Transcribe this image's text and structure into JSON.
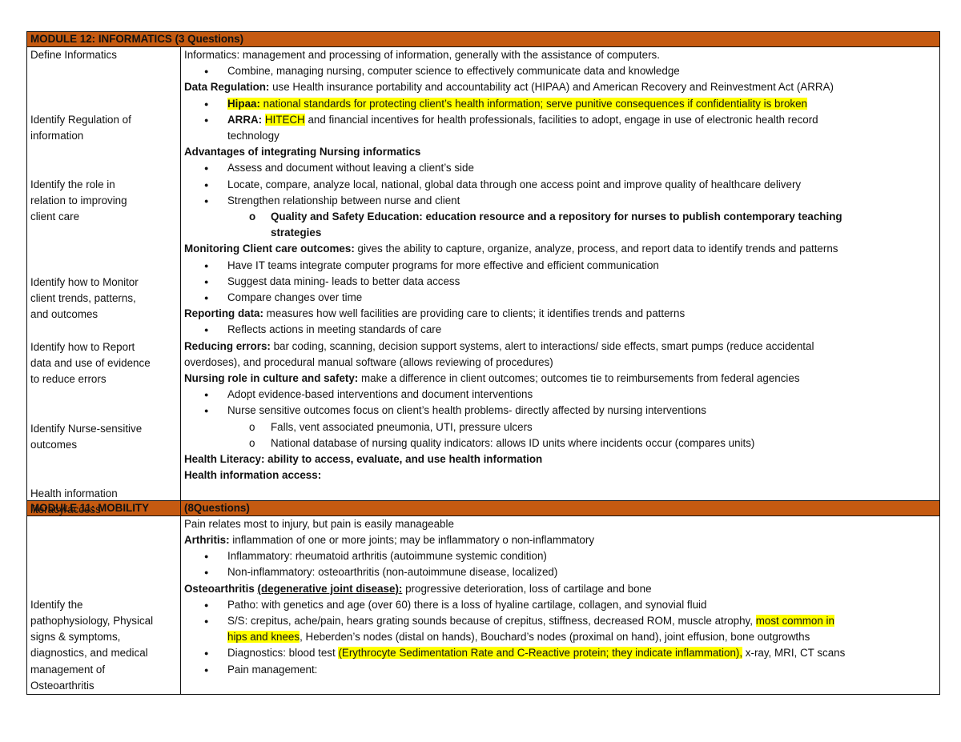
{
  "module12": {
    "header": "MODULE 12: INFORMATICS (3 Questions)",
    "left_topics": [
      "Define Informatics",
      "Identify Regulation of information",
      "Identify the role in relation to improving client care",
      "Identify how to Monitor client trends, patterns, and outcomes",
      "Identify how to Report data and use of evidence to reduce errors",
      "Identify Nurse-sensitive outcomes",
      "Health information literacy/access"
    ],
    "left_lines": {
      "t1": [
        "Define Informatics"
      ],
      "t2": [
        "Identify Regulation of",
        "information"
      ],
      "t3": [
        "Identify the role in",
        "relation to improving",
        "client care"
      ],
      "t4": [
        "Identify how to Monitor",
        "client trends, patterns,",
        "and outcomes"
      ],
      "t5": [
        "Identify how to Report",
        "data and use of evidence",
        "to reduce errors"
      ],
      "t6": [
        "Identify Nurse-sensitive",
        "outcomes"
      ],
      "t7": [
        "Health information",
        "literacy/access"
      ]
    },
    "content": {
      "informatics_term": "Informatics:",
      "informatics_def": " management and processing of information, generally with the assistance of computers.",
      "informatics_bullet": "Combine, managing nursing, computer science to effectively communicate data and knowledge",
      "data_reg_term": "Data Regulation:",
      "data_reg_def": " use Health insurance portability and accountability act (HIPAA) and American Recovery and Reinvestment Act (ARRA)",
      "hipaa_term": "Hipaa:",
      "hipaa_def": " national standards for protecting client’s health information; serve punitive consequences if confidentiality is broken",
      "arra_term": "ARRA:",
      "arra_hitech": "HITECH",
      "arra_def": " and financial incentives for health professionals, facilities to adopt, engage in use of electronic health record",
      "arra_def_cont": "technology",
      "advantages_heading": "Advantages of integrating Nursing informatics",
      "advantages_bullets": [
        "Assess and document without leaving a client’s side",
        "Locate, compare, analyze local, national, global data through one access point and improve quality of healthcare delivery",
        "Strengthen relationship between nurse and client"
      ],
      "qse_text": "Quality and Safety Education: education resource and a repository for nurses to publish contemporary teaching",
      "qse_text_cont": "strategies",
      "monitoring_term": "Monitoring Client care outcomes:",
      "monitoring_def": " gives the ability to capture, organize, analyze, process, and report data to identify trends and patterns",
      "monitoring_bullets": [
        "Have IT teams integrate computer programs for more effective and efficient communication",
        "Suggest data mining- leads to better data access",
        "Compare changes over time"
      ],
      "reporting_term": "Reporting data:",
      "reporting_def": " measures how well facilities are providing care to clients; it identifies trends and patterns",
      "reporting_bullet": "Reflects actions in meeting standards of care",
      "reducing_term": "Reducing errors:",
      "reducing_def": " bar coding, scanning, decision support systems, alert to interactions/ side effects, smart pumps (reduce accidental",
      "reducing_def_cont": "overdoses), and procedural manual software (allows reviewing of procedures)",
      "nursing_role_term": "Nursing role in culture and safety:",
      "nursing_role_def": " make a difference in client outcomes; outcomes tie to reimbursements from federal agencies",
      "nursing_role_bullets": [
        "Adopt evidence-based interventions and document interventions",
        "Nurse sensitive outcomes focus on client’s health problems- directly affected by nursing interventions"
      ],
      "nursing_role_sub": [
        "Falls, vent associated pneumonia, UTI, pressure ulcers",
        "National database of nursing quality indicators: allows ID units where incidents occur (compares units)"
      ],
      "health_literacy": "Health Literacy: ability to access, evaluate, and use health information",
      "health_info_access": "Health information access:"
    }
  },
  "module11": {
    "header_left": "MODULE 11: MOBILITY",
    "header_right": "(8Questions)",
    "left_lines": [
      "Identify the",
      "pathophysiology, Physical",
      "signs & symptoms,",
      "diagnostics, and medical",
      "management of",
      "Osteoarthritis"
    ],
    "content": {
      "pain_line": "Pain relates most to injury, but pain is easily manageable",
      "arthritis_term": "Arthritis:",
      "arthritis_def": " inflammation of one or more joints; may be inflammatory o non-inflammatory",
      "arthritis_bullets": [
        "Inflammatory: rheumatoid arthritis (autoimmune systemic condition)",
        "Non-inflammatory: osteoarthritis (non-autoimmune disease, localized)"
      ],
      "oa_term": "Osteoarthritis",
      "oa_paren": "(degenerative joint disease):",
      "oa_def": " progressive deterioration, loss of cartilage and bone",
      "patho": "Patho: with genetics and age (over 60) there is a loss of hyaline cartilage, collagen, and synovial fluid",
      "ss_pre": "S/S: crepitus, ache/pain, hears grating sounds because of crepitus, stiffness, decreased ROM, muscle atrophy, ",
      "ss_hl1": "most common in",
      "ss_hl2": "hips and knees",
      "ss_post": ", Heberden’s nodes (distal on hands), Bouchard’s nodes (proximal on hand), joint effusion, bone outgrowths",
      "diag_pre": "Diagnostics: blood test ",
      "diag_hl": "(Erythrocyte Sedimentation Rate and C-Reactive protein; they indicate inflammation),",
      "diag_post": " x-ray, MRI, CT scans",
      "pain_mgmt": "Pain management:"
    }
  },
  "colors": {
    "module_header": "#c55a11",
    "highlight": "#ffff00",
    "border": "#111111"
  }
}
